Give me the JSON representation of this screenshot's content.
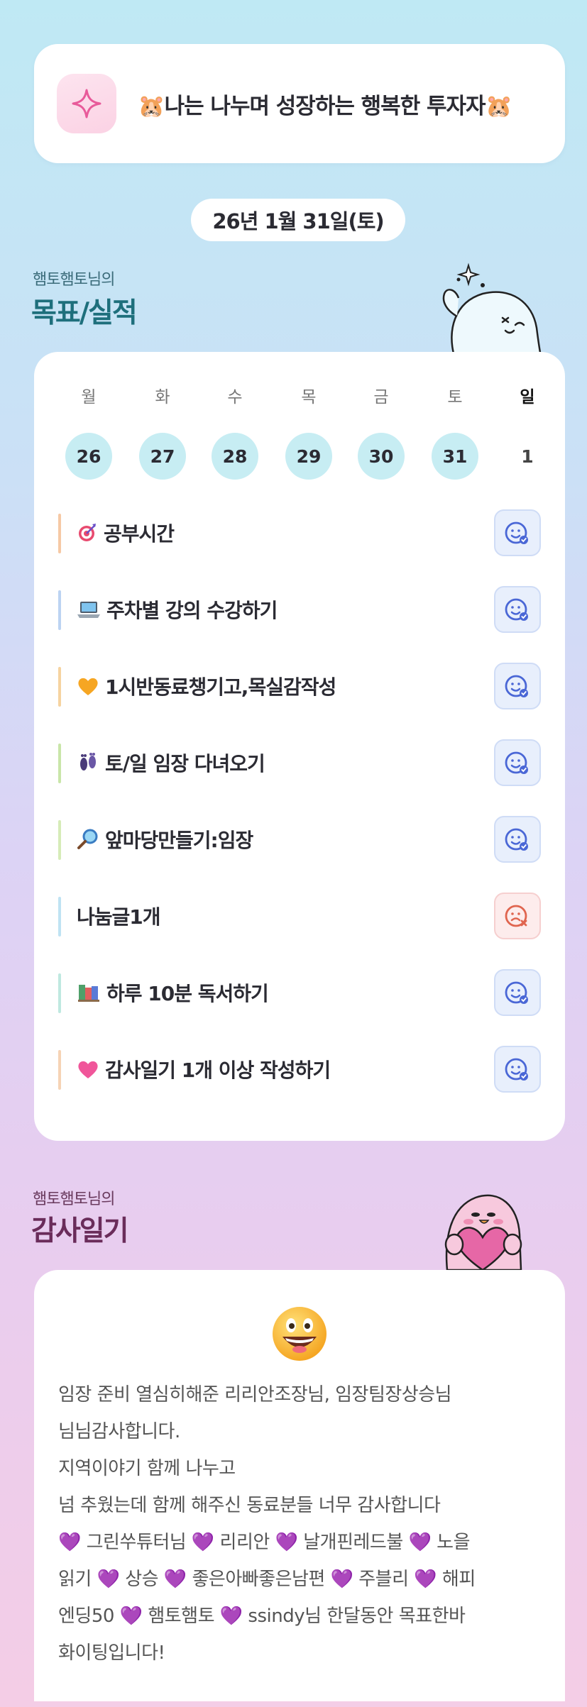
{
  "motto": {
    "text": "🐹나는 나누며 성장하는 행복한 투자자🐹"
  },
  "date": {
    "label": "26년 1월 31일(토)"
  },
  "goals_section": {
    "subtitle": "햄토햄토님의",
    "title": "목표/실적"
  },
  "week": [
    {
      "day": "월",
      "date": "26",
      "highlight": true
    },
    {
      "day": "화",
      "date": "27",
      "highlight": true
    },
    {
      "day": "수",
      "date": "28",
      "highlight": true
    },
    {
      "day": "목",
      "date": "29",
      "highlight": true
    },
    {
      "day": "금",
      "date": "30",
      "highlight": true
    },
    {
      "day": "토",
      "date": "31",
      "highlight": true
    },
    {
      "day": "일",
      "date": "1",
      "highlight": false
    }
  ],
  "goals": [
    {
      "icon": "target-icon",
      "label": "공부시간",
      "status": "done",
      "bar_color": "#f6c9a5"
    },
    {
      "icon": "laptop-icon",
      "label": "주차별 강의 수강하기",
      "status": "done",
      "bar_color": "#bcd3f2"
    },
    {
      "icon": "yellow-heart-icon",
      "label": "1시반동료챙기고,목실감작성",
      "status": "done",
      "bar_color": "#f6d3a0"
    },
    {
      "icon": "footprints-icon",
      "label": "토/일 임장 다녀오기",
      "status": "done",
      "bar_color": "#c9e6a9"
    },
    {
      "icon": "magnifier-icon",
      "label": "앞마당만들기:임장",
      "status": "done",
      "bar_color": "#d6ecb8"
    },
    {
      "icon": "",
      "label": "나눔글1개",
      "status": "missed",
      "bar_color": "#bfe3f3"
    },
    {
      "icon": "books-icon",
      "label": "하루 10분 독서하기",
      "status": "done",
      "bar_color": "#bfe9e0"
    },
    {
      "icon": "pink-heart-icon",
      "label": "감사일기 1개 이상 작성하기",
      "status": "done",
      "bar_color": "#f6d3b5"
    }
  ],
  "diary_section": {
    "subtitle": "햄토햄토님의",
    "title": "감사일기"
  },
  "diary": {
    "emoji": "grinning-face-icon",
    "lines": [
      "임장 준비 열심히해준 리리안조장님, 임장팀장상승님",
      "님님감사합니다.",
      "지역이야기 함께 나누고",
      "넘 추웠는데 함께 해주신 동료분들 너무 감사합니다",
      "💜 그린쑤튜터님 💜 리리안 💜 날개핀레드불 💜 노을",
      "읽기 💜 상승 💜 좋은아빠좋은남편 💜 주블리 💜 해피",
      "엔딩50 💜 햄토햄토 💜 ssindy님 한달동안 목표한바",
      "화이팅입니다!"
    ]
  },
  "colors": {
    "accent_teal": "#1e6f7c",
    "accent_purple": "#6a2c5a",
    "day_circle": "#c7edf3",
    "done_button": "#e8effc",
    "missed_button": "#fdecec"
  }
}
